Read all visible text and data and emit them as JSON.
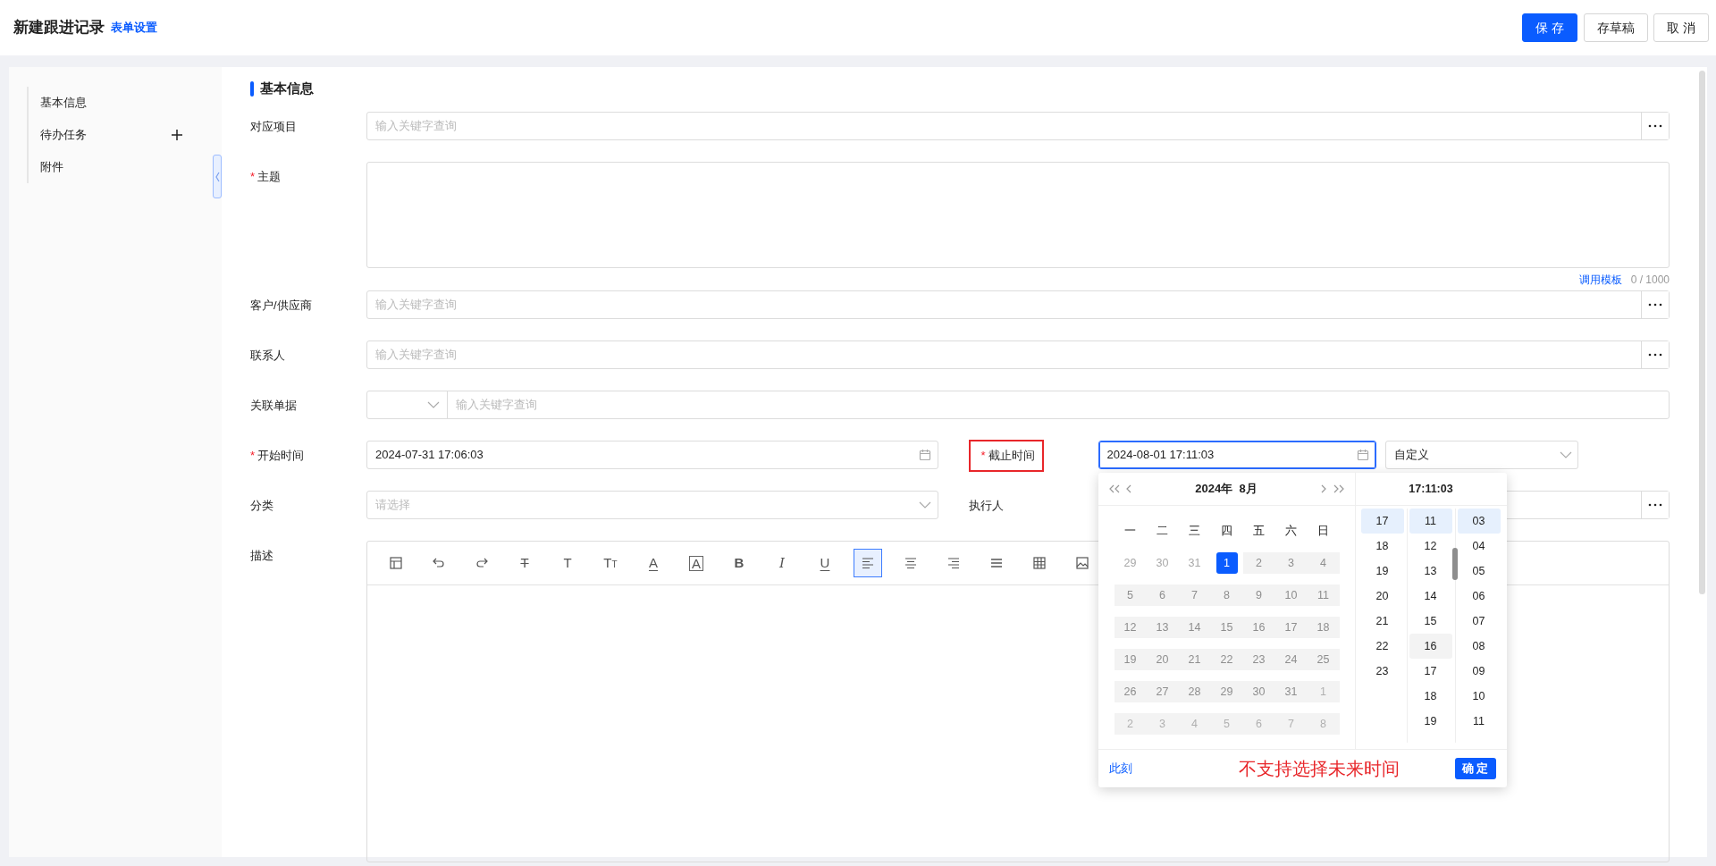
{
  "header": {
    "title": "新建跟进记录",
    "settings_link": "表单设置",
    "buttons": [
      {
        "label": "保 存",
        "kind": "primary"
      },
      {
        "label": "存草稿",
        "kind": "default"
      },
      {
        "label": "取 消",
        "kind": "default"
      }
    ]
  },
  "sidebar": {
    "items": [
      {
        "label": "基本信息"
      },
      {
        "label": "待办任务",
        "addable": true
      },
      {
        "label": "附件"
      }
    ]
  },
  "form": {
    "section_title": "基本信息",
    "required_mark": "*",
    "rows": [
      {
        "kind": "lookup",
        "label": "对应项目",
        "placeholder": "输入关键字查询"
      },
      {
        "kind": "textarea",
        "label": "主题",
        "required": true,
        "template_link": "调用模板",
        "counter": "0 / 1000"
      },
      {
        "kind": "lookup",
        "label": "客户/供应商",
        "placeholder": "输入关键字查询"
      },
      {
        "kind": "lookup",
        "label": "联系人",
        "placeholder": "输入关键字查询"
      },
      {
        "kind": "doc",
        "label": "关联单据",
        "placeholder": "输入关键字查询"
      },
      {
        "kind": "pair",
        "left": {
          "kind": "datetime",
          "label": "开始时间",
          "required": true,
          "value": "2024-07-31 17:06:03",
          "focused": false
        },
        "right": {
          "kind": "datetime",
          "label": "截止时间",
          "required": true,
          "value": "2024-08-01 17:11:03",
          "focused": true,
          "annotated": true,
          "mode": "自定义"
        }
      },
      {
        "kind": "pair",
        "left": {
          "kind": "select",
          "label": "分类",
          "placeholder": "请选择"
        },
        "right": {
          "kind": "lookup",
          "label": "执行人"
        }
      },
      {
        "kind": "editor",
        "label": "描述"
      }
    ]
  },
  "toolbar": [
    {
      "kind": "layout",
      "selected": false
    },
    {
      "kind": "undo",
      "selected": false
    },
    {
      "kind": "redo",
      "selected": false
    },
    {
      "kind": "strike",
      "glyph": "T",
      "selected": false
    },
    {
      "kind": "plain",
      "glyph": "T",
      "selected": false
    },
    {
      "kind": "size",
      "glyph": "T",
      "small": "T",
      "selected": false
    },
    {
      "kind": "font-color",
      "glyph": "A",
      "selected": false
    },
    {
      "kind": "bg-color",
      "glyph": "A",
      "selected": false
    },
    {
      "kind": "bold",
      "glyph": "B",
      "selected": false
    },
    {
      "kind": "italic",
      "glyph": "I",
      "selected": false
    },
    {
      "kind": "underline",
      "glyph": "U",
      "selected": false
    },
    {
      "kind": "align-left",
      "selected": true
    },
    {
      "kind": "align-center",
      "selected": false
    },
    {
      "kind": "align-right",
      "selected": false
    },
    {
      "kind": "justify",
      "selected": false
    },
    {
      "kind": "table",
      "selected": false
    },
    {
      "kind": "image",
      "selected": false
    }
  ],
  "picker": {
    "month_title": "2024年  8月",
    "time_title": "17:11:03",
    "weekdays": [
      "一",
      "二",
      "三",
      "四",
      "五",
      "六",
      "日"
    ],
    "weeks": [
      [
        {
          "day": "29",
          "outside": true,
          "disabled": false,
          "selected": false
        },
        {
          "day": "30",
          "outside": true,
          "disabled": false,
          "selected": false
        },
        {
          "day": "31",
          "outside": true,
          "disabled": false,
          "selected": false
        },
        {
          "day": "1",
          "outside": false,
          "disabled": false,
          "selected": true
        },
        {
          "day": "2",
          "outside": false,
          "disabled": true,
          "selected": false
        },
        {
          "day": "3",
          "outside": false,
          "disabled": true,
          "selected": false
        },
        {
          "day": "4",
          "outside": false,
          "disabled": true,
          "selected": false
        }
      ],
      [
        {
          "day": "5",
          "outside": false,
          "disabled": true,
          "selected": false
        },
        {
          "day": "6",
          "outside": false,
          "disabled": true,
          "selected": false
        },
        {
          "day": "7",
          "outside": false,
          "disabled": true,
          "selected": false
        },
        {
          "day": "8",
          "outside": false,
          "disabled": true,
          "selected": false
        },
        {
          "day": "9",
          "outside": false,
          "disabled": true,
          "selected": false
        },
        {
          "day": "10",
          "outside": false,
          "disabled": true,
          "selected": false
        },
        {
          "day": "11",
          "outside": false,
          "disabled": true,
          "selected": false
        }
      ],
      [
        {
          "day": "12",
          "outside": false,
          "disabled": true,
          "selected": false
        },
        {
          "day": "13",
          "outside": false,
          "disabled": true,
          "selected": false
        },
        {
          "day": "14",
          "outside": false,
          "disabled": true,
          "selected": false
        },
        {
          "day": "15",
          "outside": false,
          "disabled": true,
          "selected": false
        },
        {
          "day": "16",
          "outside": false,
          "disabled": true,
          "selected": false
        },
        {
          "day": "17",
          "outside": false,
          "disabled": true,
          "selected": false
        },
        {
          "day": "18",
          "outside": false,
          "disabled": true,
          "selected": false
        }
      ],
      [
        {
          "day": "19",
          "outside": false,
          "disabled": true,
          "selected": false
        },
        {
          "day": "20",
          "outside": false,
          "disabled": true,
          "selected": false
        },
        {
          "day": "21",
          "outside": false,
          "disabled": true,
          "selected": false
        },
        {
          "day": "22",
          "outside": false,
          "disabled": true,
          "selected": false
        },
        {
          "day": "23",
          "outside": false,
          "disabled": true,
          "selected": false
        },
        {
          "day": "24",
          "outside": false,
          "disabled": true,
          "selected": false
        },
        {
          "day": "25",
          "outside": false,
          "disabled": true,
          "selected": false
        }
      ],
      [
        {
          "day": "26",
          "outside": false,
          "disabled": true,
          "selected": false
        },
        {
          "day": "27",
          "outside": false,
          "disabled": true,
          "selected": false
        },
        {
          "day": "28",
          "outside": false,
          "disabled": true,
          "selected": false
        },
        {
          "day": "29",
          "outside": false,
          "disabled": true,
          "selected": false
        },
        {
          "day": "30",
          "outside": false,
          "disabled": true,
          "selected": false
        },
        {
          "day": "31",
          "outside": false,
          "disabled": true,
          "selected": false
        },
        {
          "day": "1",
          "outside": true,
          "disabled": true,
          "selected": false
        }
      ],
      [
        {
          "day": "2",
          "outside": true,
          "disabled": true,
          "selected": false
        },
        {
          "day": "3",
          "outside": true,
          "disabled": true,
          "selected": false
        },
        {
          "day": "4",
          "outside": true,
          "disabled": true,
          "selected": false
        },
        {
          "day": "5",
          "outside": true,
          "disabled": true,
          "selected": false
        },
        {
          "day": "6",
          "outside": true,
          "disabled": true,
          "selected": false
        },
        {
          "day": "7",
          "outside": true,
          "disabled": true,
          "selected": false
        },
        {
          "day": "8",
          "outside": true,
          "disabled": true,
          "selected": false
        }
      ]
    ],
    "hours": [
      {
        "label": "17",
        "selected": true,
        "hovered": false
      },
      {
        "label": "18",
        "selected": false,
        "hovered": false
      },
      {
        "label": "19",
        "selected": false,
        "hovered": false
      },
      {
        "label": "20",
        "selected": false,
        "hovered": false
      },
      {
        "label": "21",
        "selected": false,
        "hovered": false
      },
      {
        "label": "22",
        "selected": false,
        "hovered": false
      },
      {
        "label": "23",
        "selected": false,
        "hovered": false
      }
    ],
    "minutes": [
      {
        "label": "11",
        "selected": true,
        "hovered": false
      },
      {
        "label": "12",
        "selected": false,
        "hovered": false
      },
      {
        "label": "13",
        "selected": false,
        "hovered": false
      },
      {
        "label": "14",
        "selected": false,
        "hovered": false
      },
      {
        "label": "15",
        "selected": false,
        "hovered": false
      },
      {
        "label": "16",
        "selected": false,
        "hovered": true
      },
      {
        "label": "17",
        "selected": false,
        "hovered": false
      },
      {
        "label": "18",
        "selected": false,
        "hovered": false
      },
      {
        "label": "19",
        "selected": false,
        "hovered": false
      }
    ],
    "seconds": [
      {
        "label": "03",
        "selected": true,
        "hovered": false
      },
      {
        "label": "04",
        "selected": false,
        "hovered": false
      },
      {
        "label": "05",
        "selected": false,
        "hovered": false
      },
      {
        "label": "06",
        "selected": false,
        "hovered": false
      },
      {
        "label": "07",
        "selected": false,
        "hovered": false
      },
      {
        "label": "08",
        "selected": false,
        "hovered": false
      },
      {
        "label": "09",
        "selected": false,
        "hovered": false
      },
      {
        "label": "10",
        "selected": false,
        "hovered": false
      },
      {
        "label": "11",
        "selected": false,
        "hovered": false
      }
    ],
    "now_link": "此刻",
    "note": "不支持选择未来时间",
    "confirm": "确 定"
  }
}
